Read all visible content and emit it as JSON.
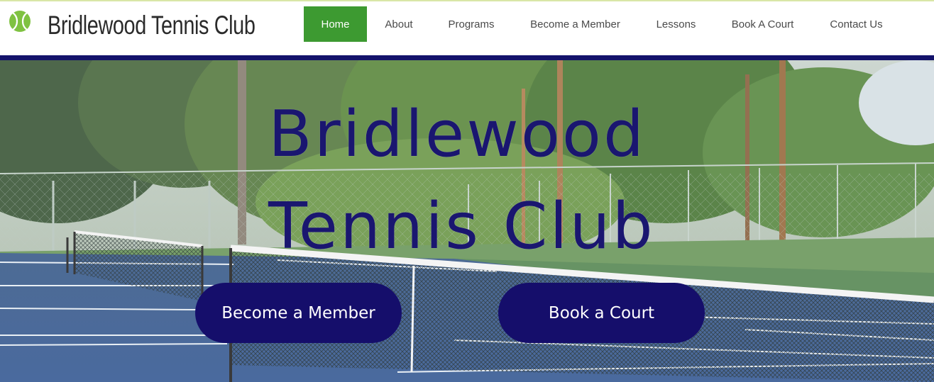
{
  "site": {
    "title": "Bridlewood Tennis Club",
    "logo_icon": "tennis-ball-icon"
  },
  "nav": {
    "items": [
      {
        "label": "Home",
        "active": true
      },
      {
        "label": "About",
        "active": false
      },
      {
        "label": "Programs",
        "active": false
      },
      {
        "label": "Become a Member",
        "active": false
      },
      {
        "label": "Lessons",
        "active": false
      },
      {
        "label": "Book A Court",
        "active": false
      },
      {
        "label": "Contact Us",
        "active": false
      }
    ]
  },
  "hero": {
    "title_line1": "Bridlewood",
    "title_line2": "Tennis Club",
    "primary_cta": "Become a Member",
    "secondary_cta": "Book a Court"
  },
  "colors": {
    "accent_green": "#3d9a31",
    "navy": "#14136b",
    "title_text": "#2b2b2b"
  }
}
